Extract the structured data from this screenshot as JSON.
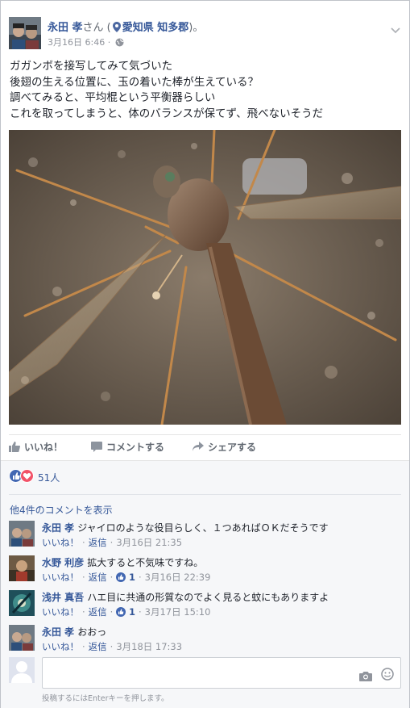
{
  "post": {
    "author": "永田 孝",
    "author_suffix": "さん (",
    "location": "愛知県 知多郡",
    "location_suffix": ")。",
    "timestamp": "3月16日 6:46",
    "privacy_dot": "·",
    "lines": [
      "ガガンボを接写してみて気づいた",
      "後翅の生える位置に、玉の着いた棒が生えている？",
      "調べてみると、平均棍という平衡器らしい",
      "これを取ってしまうと、体のバランスが保てず、飛べないそうだ"
    ]
  },
  "actions": {
    "like": "いいね！",
    "comment": "コメントする",
    "share": "シェアする"
  },
  "reactions": {
    "count": "51人",
    "colors": {
      "like": "#4267b2",
      "love": "#f25268"
    }
  },
  "comments_section": {
    "more_link": "他4件のコメントを表示",
    "like_label": "いいね！",
    "reply_label": "返信",
    "dot": "·",
    "items": [
      {
        "name": "永田 孝",
        "text": "ジャイロのような役目らしく、１つあればＯＫだそうです",
        "likes": "",
        "time": "3月16日 21:35"
      },
      {
        "name": "水野 利彦",
        "text": "拡大すると不気味ですね。",
        "likes": "1",
        "time": "3月16日 22:39"
      },
      {
        "name": "浅井 真吾",
        "text": "ハエ目に共通の形質なのでよく見ると蚊にもありますよ",
        "likes": "1",
        "time": "3月17日 15:10"
      },
      {
        "name": "永田 孝",
        "text": "おおっ",
        "likes": "",
        "time": "3月18日 17:33"
      }
    ]
  },
  "reply": {
    "hint": "投稿するにはEnterキーを押します。"
  },
  "icons": {
    "pin": "map-pin-icon",
    "globe": "globe-icon",
    "chevron": "chevron-down-icon",
    "like": "thumbs-up-icon",
    "comment": "speech-bubble-icon",
    "share": "share-arrow-icon",
    "camera": "camera-icon",
    "smile": "emoji-icon"
  }
}
